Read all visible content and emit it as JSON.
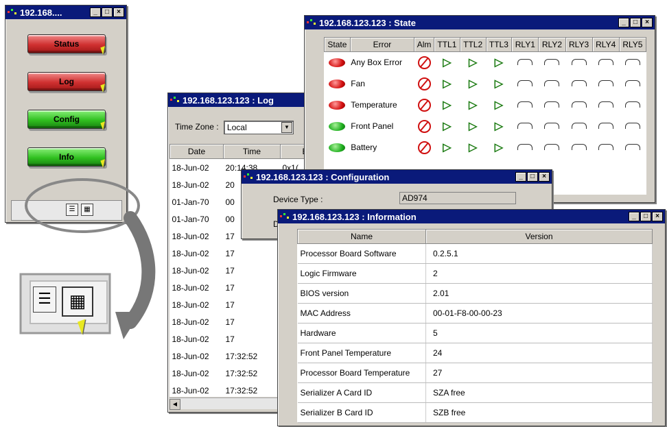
{
  "colors": {
    "titlebar": "#0a1a7a",
    "red_led": "#d41010",
    "green_led": "#20b020",
    "ttl_green": "#1a7a10"
  },
  "panel": {
    "title": "192.168....",
    "buttons": [
      {
        "label": "Status",
        "color": "red"
      },
      {
        "label": "Log",
        "color": "red"
      },
      {
        "label": "Config",
        "color": "green"
      },
      {
        "label": "Info",
        "color": "green"
      }
    ]
  },
  "state_window": {
    "title": "192.168.123.123 : State",
    "columns": [
      "State",
      "Error",
      "Alm",
      "TTL1",
      "TTL2",
      "TTL3",
      "RLY1",
      "RLY2",
      "RLY3",
      "RLY4",
      "RLY5"
    ],
    "rows": [
      {
        "state": "red",
        "error": "Any Box Error"
      },
      {
        "state": "red",
        "error": "Fan"
      },
      {
        "state": "red",
        "error": "Temperature"
      },
      {
        "state": "green",
        "error": "Front Panel"
      },
      {
        "state": "green",
        "error": "Battery"
      }
    ]
  },
  "log_window": {
    "title": "192.168.123.123 : Log",
    "timezone_label": "Time Zone :",
    "timezone_value": "Local",
    "columns": [
      "Date",
      "Time",
      "Ev"
    ],
    "rows": [
      {
        "date": "18-Jun-02",
        "time": "20:14:38",
        "ev": "0x1("
      },
      {
        "date": "18-Jun-02",
        "time": "20",
        "ev": ""
      },
      {
        "date": "01-Jan-70",
        "time": "00",
        "ev": ""
      },
      {
        "date": "01-Jan-70",
        "time": "00",
        "ev": ""
      },
      {
        "date": "18-Jun-02",
        "time": "17",
        "ev": ""
      },
      {
        "date": "18-Jun-02",
        "time": "17",
        "ev": ""
      },
      {
        "date": "18-Jun-02",
        "time": "17",
        "ev": ""
      },
      {
        "date": "18-Jun-02",
        "time": "17",
        "ev": ""
      },
      {
        "date": "18-Jun-02",
        "time": "17",
        "ev": ""
      },
      {
        "date": "18-Jun-02",
        "time": "17",
        "ev": ""
      },
      {
        "date": "18-Jun-02",
        "time": "17",
        "ev": ""
      },
      {
        "date": "18-Jun-02",
        "time": "17:32:52",
        "ev": ""
      },
      {
        "date": "18-Jun-02",
        "time": "17:32:52",
        "ev": ""
      },
      {
        "date": "18-Jun-02",
        "time": "17:32:52",
        "ev": ""
      }
    ]
  },
  "config_window": {
    "title": "192.168.123.123 : Configuration",
    "device_type_label": "Device Type :",
    "device_type_value": "AD974",
    "partial_label": "D"
  },
  "info_window": {
    "title": "192.168.123.123 : Information",
    "columns": [
      "Name",
      "Version"
    ],
    "rows": [
      {
        "name": "Processor Board Software",
        "version": "0.2.5.1"
      },
      {
        "name": "Logic Firmware",
        "version": "2"
      },
      {
        "name": "BIOS version",
        "version": "2.01"
      },
      {
        "name": "MAC Address",
        "version": "00-01-F8-00-00-23"
      },
      {
        "name": "Hardware",
        "version": "5"
      },
      {
        "name": "Front Panel Temperature",
        "version": "24"
      },
      {
        "name": "Processor Board Temperature",
        "version": "27"
      },
      {
        "name": "Serializer A Card ID",
        "version": "SZA free"
      },
      {
        "name": "Serializer B Card ID",
        "version": "SZB free"
      }
    ]
  },
  "icons": [
    "app-icon",
    "minimize-icon",
    "maximize-icon",
    "close-icon",
    "cursor-icon",
    "list-view-icon",
    "detail-view-icon",
    "red-led-icon",
    "green-led-icon",
    "alarm-icon",
    "ttl-icon",
    "relay-icon",
    "dropdown-arrow-icon"
  ]
}
